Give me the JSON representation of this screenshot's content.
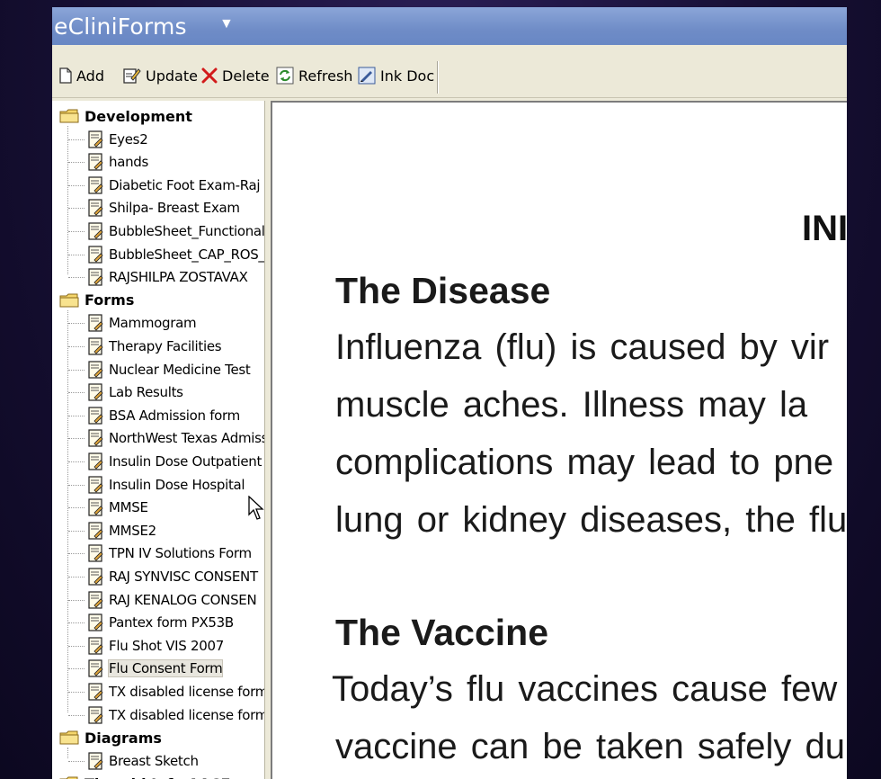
{
  "app": {
    "title": "eCliniForms"
  },
  "toolbar": {
    "add": "Add",
    "update": "Update",
    "delete": "Delete",
    "refresh": "Refresh",
    "ink_doc": "Ink Doc"
  },
  "tree": {
    "folders": [
      {
        "label": "Development",
        "items": [
          "Eyes2",
          "hands",
          "Diabetic Foot Exam-Raj S",
          "Shilpa- Breast Exam",
          "BubbleSheet_Functional_",
          "BubbleSheet_CAP_ROS_",
          "RAJSHILPA ZOSTAVAX"
        ]
      },
      {
        "label": "Forms",
        "items": [
          "Mammogram",
          "Therapy Facilities",
          "Nuclear Medicine Test",
          "Lab Results",
          "BSA Admission form",
          "NorthWest Texas Admiss",
          "Insulin Dose Outpatient",
          "Insulin Dose Hospital",
          "MMSE",
          "MMSE2",
          "TPN IV Solutions Form",
          "RAJ SYNVISC CONSENT",
          "RAJ KENALOG CONSEN",
          "Pantex form PX53B",
          "Flu Shot VIS 2007",
          "Flu Consent Form",
          "TX disabled license form",
          "TX disabled license form |"
        ]
      },
      {
        "label": "Diagrams",
        "items": [
          "Breast Sketch"
        ]
      },
      {
        "label": "Thyroid Info AACE",
        "items": []
      }
    ],
    "selected_item": "Flu Consent Form"
  },
  "document": {
    "title_fragment": "INI",
    "section1_heading": "The Disease",
    "section1_lines": [
      "Influenza (flu) is caused by vir",
      "muscle aches. Illness may la",
      "complications may lead to pne",
      "lung or kidney diseases, the flu"
    ],
    "section2_heading": "The Vaccine",
    "section2_lines": [
      "Today’s flu vaccines cause few",
      "vaccine can be taken safely du"
    ]
  },
  "icons": {
    "folder": "folder-icon",
    "form": "form-icon",
    "add": "new-page-icon",
    "update": "edit-icon",
    "delete": "x-icon",
    "refresh": "refresh-icon",
    "ink": "ink-doc-icon"
  }
}
